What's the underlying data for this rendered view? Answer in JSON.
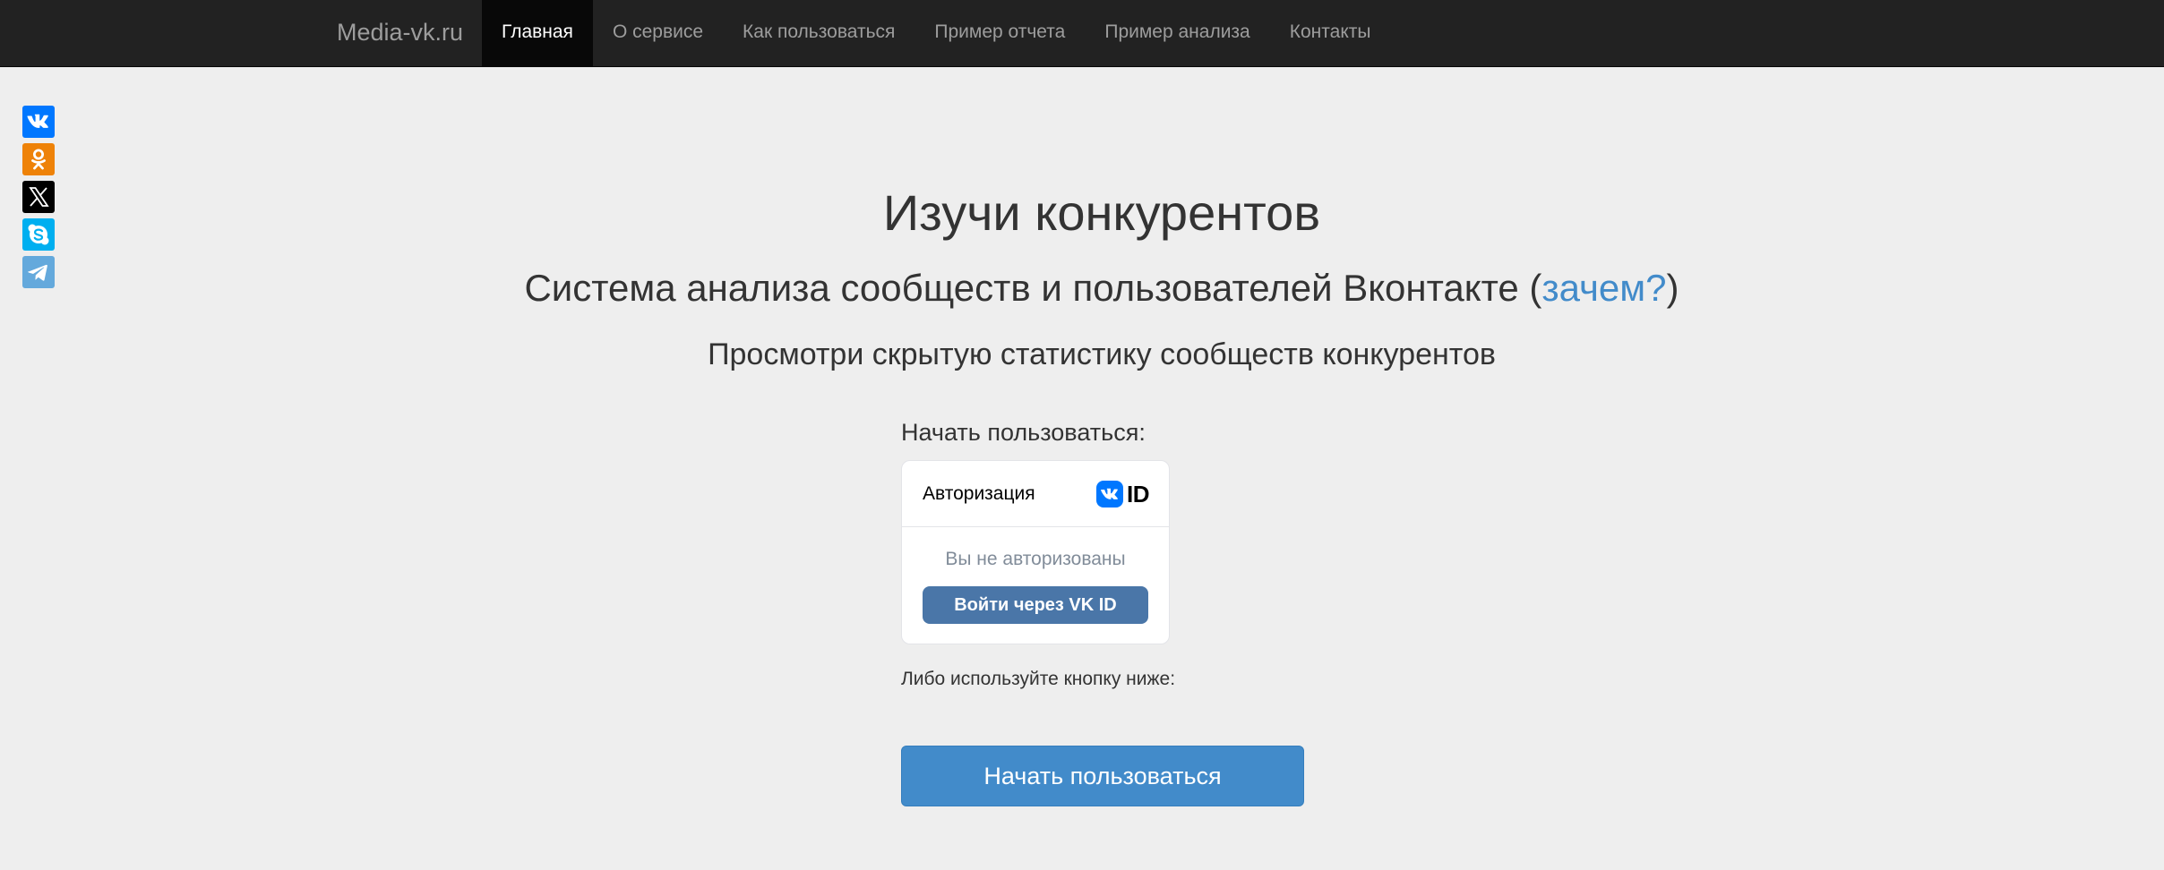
{
  "navbar": {
    "brand": "Media-vk.ru",
    "items": [
      {
        "label": "Главная",
        "active": true
      },
      {
        "label": "О сервисе",
        "active": false
      },
      {
        "label": "Как пользоваться",
        "active": false
      },
      {
        "label": "Пример отчета",
        "active": false
      },
      {
        "label": "Пример анализа",
        "active": false
      },
      {
        "label": "Контакты",
        "active": false
      }
    ]
  },
  "share": {
    "buttons": [
      {
        "icon": "vk-icon",
        "color": "#0077ff"
      },
      {
        "icon": "odnoklassniki-icon",
        "color": "#ee8208"
      },
      {
        "icon": "x-twitter-icon",
        "color": "#000000"
      },
      {
        "icon": "skype-icon",
        "color": "#00aff0"
      },
      {
        "icon": "telegram-icon",
        "color": "#64a9dc"
      }
    ]
  },
  "hero": {
    "title": "Изучи конкурентов",
    "subtitle_prefix": "Система анализа сообществ и пользователей Вконтакте (",
    "subtitle_link": "зачем?",
    "subtitle_suffix": ")",
    "tagline": "Просмотри скрытую статистику сообществ конкурентов"
  },
  "start_label": "Начать пользоваться:",
  "vk_widget": {
    "title": "Авторизация",
    "logo_text": "ID",
    "status": "Вы не авторизованы",
    "login_button": "Войти через VK ID"
  },
  "alt_label": "Либо используйте кнопку ниже:",
  "start_button": "Начать пользоваться",
  "colors": {
    "navbar_bg": "#222222",
    "accent": "#428bca",
    "vk_button": "#4a76a8",
    "page_bg": "#eeeeee"
  }
}
